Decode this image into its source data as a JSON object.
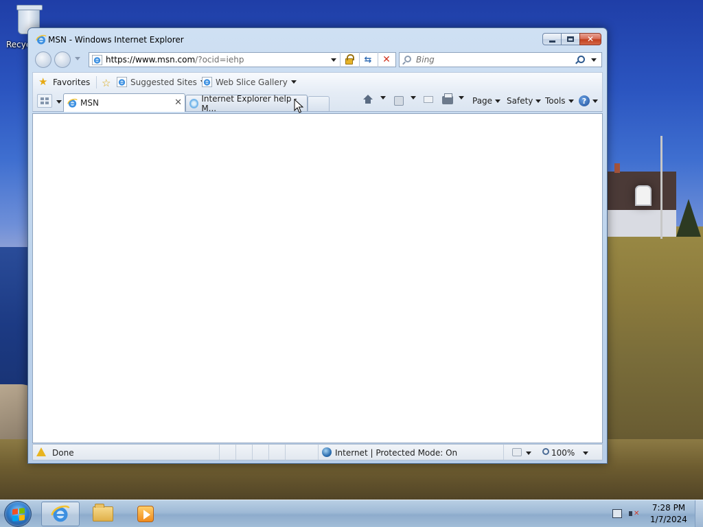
{
  "desktop": {
    "recycle_bin_label": "Recycle Bin"
  },
  "window": {
    "title": "MSN - Windows Internet Explorer",
    "address": {
      "url_main": "https://www.msn.com",
      "url_rest": "/?ocid=iehp"
    },
    "search": {
      "placeholder": "Bing"
    },
    "favorites_bar": {
      "favorites_label": "Favorites",
      "suggested_sites_label": "Suggested Sites",
      "web_slice_gallery_label": "Web Slice Gallery"
    },
    "tabs": [
      {
        "label": "MSN",
        "active": true
      },
      {
        "label": "Internet Explorer help - M...",
        "active": false
      }
    ],
    "commands": {
      "page_label": "Page",
      "safety_label": "Safety",
      "tools_label": "Tools"
    },
    "status_bar": {
      "status_text": "Done",
      "zone_text": "Internet | Protected Mode: On",
      "zoom_text": "100%"
    }
  },
  "taskbar": {
    "clock_time": "7:28 PM",
    "clock_date": "1/7/2024"
  },
  "icons": {
    "ie": "internet-explorer-icon",
    "star": "favorites-star-icon",
    "lock": "lock-icon",
    "refresh": "refresh-icon",
    "stop": "stop-icon",
    "search": "search-icon",
    "home": "home-icon",
    "feeds": "rss-feed-icon",
    "mail": "mail-icon",
    "print": "print-icon",
    "help": "help-icon"
  },
  "colors": {
    "close_button": "#c2401f",
    "window_frame": "#bcd3ec",
    "taskbar": "#9fbad6"
  }
}
